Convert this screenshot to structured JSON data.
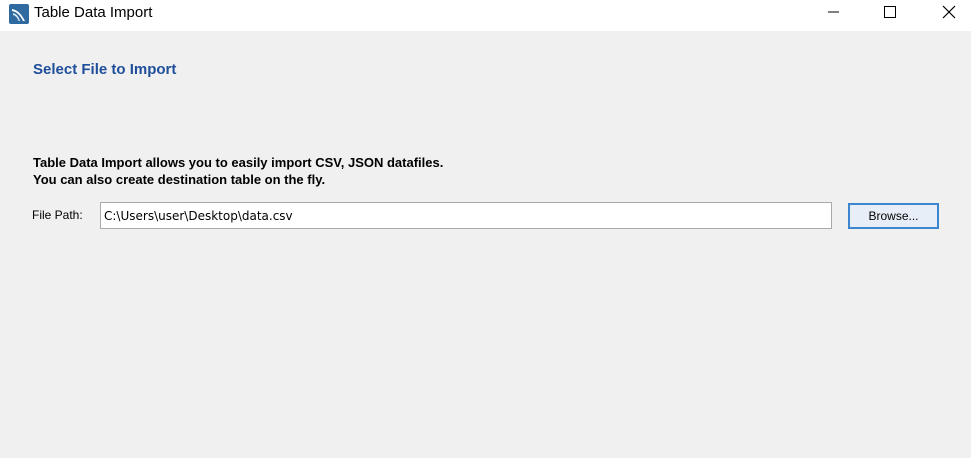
{
  "window": {
    "title": "Table Data Import",
    "icons": {
      "app": "mysql-workbench-dolphin-icon",
      "minimize": "minimize-icon",
      "maximize": "maximize-icon",
      "close": "close-icon"
    }
  },
  "main": {
    "heading": "Select File to Import",
    "description_line1": "Table Data Import allows you to easily import CSV, JSON datafiles.",
    "description_line2": "You can also create destination table on the fly.",
    "file_path_label": "File Path:",
    "file_path_value": "C:\\Users\\user\\Desktop\\data.csv",
    "browse_label": "Browse..."
  },
  "colors": {
    "heading": "#1f4e9a",
    "background": "#f0f0f0",
    "accent_border": "#3c86d0"
  }
}
